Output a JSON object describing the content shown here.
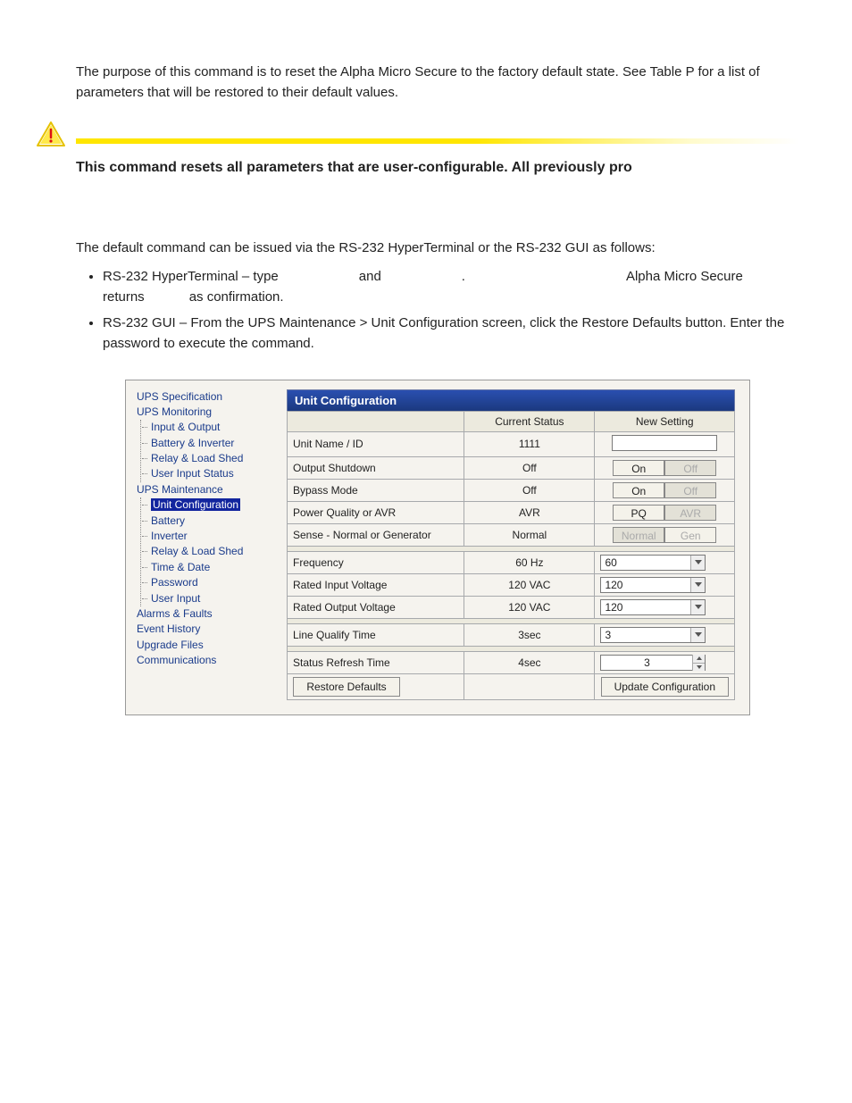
{
  "intro": "The purpose of this command is to reset the Alpha Micro Secure to the factory default state. See Table P for a list of parameters that will be restored to their default values.",
  "bold_warning": "This command resets all parameters that are user-configurable. All previously pro",
  "para2": "The default command can be issued via the RS-232 HyperTerminal or the RS-232 GUI as follows:",
  "bullet1": {
    "prefix": "RS-232 HyperTerminal – type",
    "mid1": "and",
    "mid2": ".",
    "right": "Alpha Micro Secure",
    "line2a": "returns",
    "line2b": "as confirmation."
  },
  "bullet2": "RS-232 GUI – From the UPS Maintenance > Unit Configuration screen, click the Restore Defaults button. Enter the password to execute the command.",
  "tree": {
    "n0": "UPS Specification",
    "n1": "UPS Monitoring",
    "n1c": [
      "Input & Output",
      "Battery & Inverter",
      "Relay & Load Shed",
      "User Input Status"
    ],
    "n2": "UPS Maintenance",
    "n2c": [
      "Unit Configuration",
      "Battery",
      "Inverter",
      "Relay & Load Shed",
      "Time & Date",
      "Password",
      "User Input"
    ],
    "n3": "Alarms & Faults",
    "n4": "Event History",
    "n5": "Upgrade Files",
    "n6": "Communications"
  },
  "panel": {
    "title": "Unit Configuration",
    "col_status": "Current Status",
    "col_new": "New Setting",
    "rows": [
      {
        "label": "Unit Name / ID",
        "status": "1111",
        "ctrl": "text",
        "value": ""
      },
      {
        "label": "Output Shutdown",
        "status": "Off",
        "ctrl": "onoff",
        "opts": [
          "On",
          "Off"
        ],
        "sel": 1
      },
      {
        "label": "Bypass Mode",
        "status": "Off",
        "ctrl": "onoff",
        "opts": [
          "On",
          "Off"
        ],
        "sel": 1
      },
      {
        "label": "Power Quality or AVR",
        "status": "AVR",
        "ctrl": "onoff",
        "opts": [
          "PQ",
          "AVR"
        ],
        "sel": 1
      },
      {
        "label": "Sense - Normal or Generator",
        "status": "Normal",
        "ctrl": "onoff",
        "opts": [
          "Normal",
          "Gen"
        ],
        "sel": 0,
        "dim": true
      }
    ],
    "rows2": [
      {
        "label": "Frequency",
        "status": "60 Hz",
        "ctrl": "dd",
        "value": "60"
      },
      {
        "label": "Rated Input Voltage",
        "status": "120 VAC",
        "ctrl": "dd",
        "value": "120"
      },
      {
        "label": "Rated Output Voltage",
        "status": "120 VAC",
        "ctrl": "dd",
        "value": "120"
      }
    ],
    "rows3": [
      {
        "label": "Line Qualify Time",
        "status": "3sec",
        "ctrl": "dd",
        "value": "3"
      }
    ],
    "rows4": [
      {
        "label": "Status Refresh Time",
        "status": "4sec",
        "ctrl": "spin",
        "value": "3"
      }
    ],
    "btn_restore": "Restore Defaults",
    "btn_update": "Update Configuration"
  }
}
